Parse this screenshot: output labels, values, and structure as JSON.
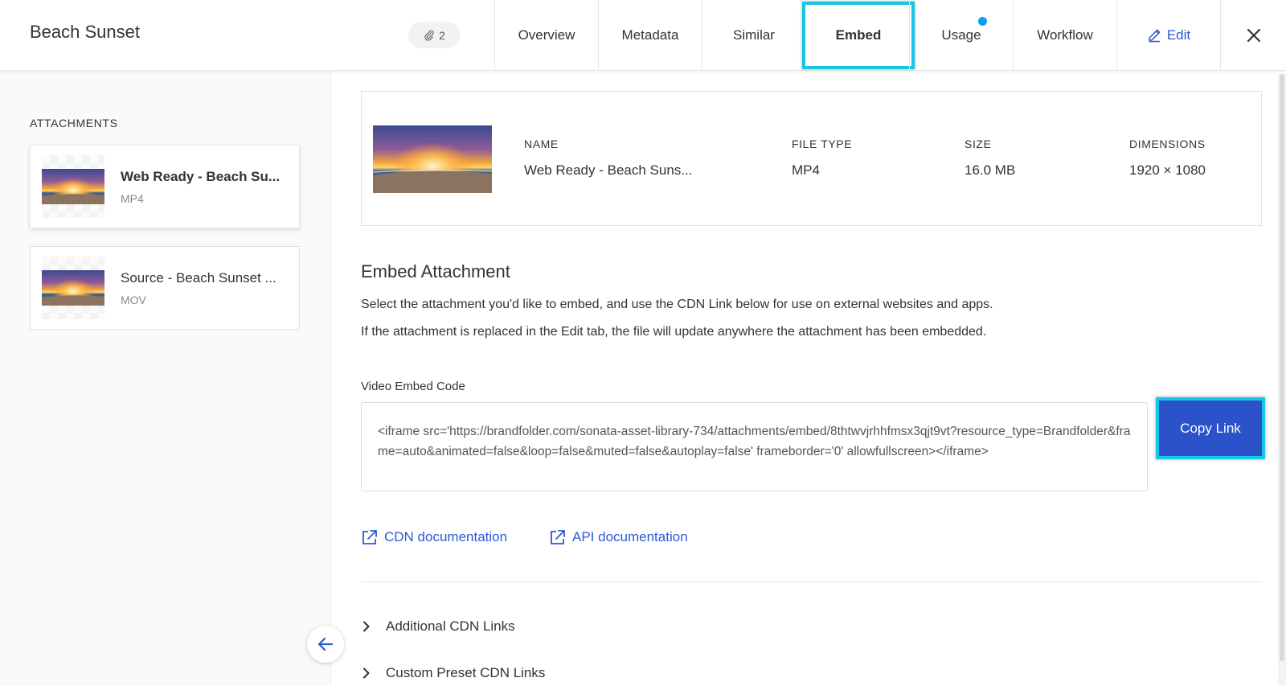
{
  "header": {
    "title": "Beach Sunset",
    "attachment_count": "2",
    "tabs": [
      {
        "label": "Overview"
      },
      {
        "label": "Metadata"
      },
      {
        "label": "Similar"
      },
      {
        "label": "Embed"
      },
      {
        "label": "Usage"
      },
      {
        "label": "Workflow"
      },
      {
        "label": "Edit"
      }
    ]
  },
  "sidebar": {
    "heading": "ATTACHMENTS",
    "items": [
      {
        "name": "Web Ready - Beach Su...",
        "type": "MP4"
      },
      {
        "name": "Source - Beach Sunset ...",
        "type": "MOV"
      }
    ]
  },
  "info": {
    "columns": [
      {
        "label": "NAME",
        "value": "Web Ready - Beach Suns..."
      },
      {
        "label": "FILE TYPE",
        "value": "MP4"
      },
      {
        "label": "SIZE",
        "value": "16.0 MB"
      },
      {
        "label": "DIMENSIONS",
        "value": "1920 × 1080"
      }
    ]
  },
  "embed": {
    "title": "Embed Attachment",
    "desc1": "Select the attachment you'd like to embed, and use the CDN Link below for use on external websites and apps.",
    "desc2": "If the attachment is replaced in the Edit tab, the file will update anywhere the attachment has been embedded.",
    "code_label": "Video Embed Code",
    "code": "<iframe src='https://brandfolder.com/sonata-asset-library-734/attachments/embed/8thtwvjrhhfmsx3qjt9vt?resource_type=Brandfolder&frame=auto&animated=false&loop=false&muted=false&autoplay=false' frameborder='0' allowfullscreen></iframe>",
    "copy_button": "Copy Link",
    "cdn_doc": "CDN documentation",
    "api_doc": "API documentation",
    "expanders": [
      "Additional CDN Links",
      "Custom Preset CDN Links"
    ]
  },
  "colors": {
    "accent": "#2b59d6",
    "highlight": "#18c7e8",
    "button": "#2b52c9",
    "notification_dot": "#0c9ef2"
  }
}
